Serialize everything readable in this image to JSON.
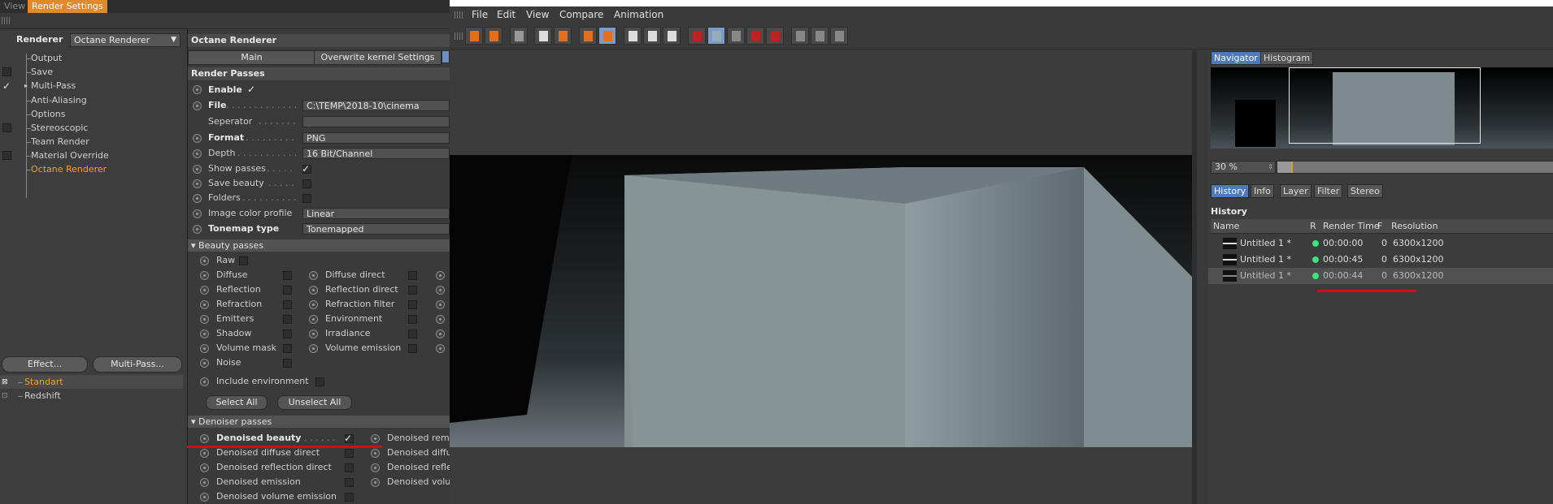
{
  "top_tabs": [
    "View",
    "Render Settings"
  ],
  "left": {
    "renderer_label": "Renderer",
    "renderer_value": "Octane Renderer",
    "tree": [
      "Output",
      "Save",
      "Multi-Pass",
      "Anti-Aliasing",
      "Options",
      "Stereoscopic",
      "Team Render",
      "Material Override",
      "Octane Renderer"
    ],
    "effect_button": "Effect...",
    "multipass_button": "Multi-Pass...",
    "settings_list": [
      "Standart",
      "Redshift"
    ]
  },
  "settings": {
    "header": "Octane Renderer",
    "tabs": [
      "Main",
      "Overwrite kernel Settings"
    ],
    "section": "Render Passes",
    "enable_label": "Enable",
    "file_label": "File",
    "file_value": "C:\\TEMP\\2018-10\\cinema",
    "separator_label": "Seperator",
    "separator_value": "_",
    "format_label": "Format",
    "format_value": "PNG",
    "depth_label": "Depth",
    "depth_value": "16 Bit/Channel",
    "show_passes_label": "Show passes",
    "save_beauty_label": "Save beauty",
    "folders_label": "Folders",
    "color_profile_label": "Image color profile",
    "color_profile_value": "Linear",
    "tonemap_label": "Tonemap type",
    "tonemap_value": "Tonemapped",
    "beauty_header": "Beauty passes",
    "beauty_raw": "Raw",
    "beauty_col1": [
      "Diffuse",
      "Reflection",
      "Refraction",
      "Emitters",
      "Shadow",
      "Volume mask",
      "Noise"
    ],
    "beauty_col2": [
      "Diffuse direct",
      "Reflection direct",
      "Refraction filter",
      "Environment",
      "Irradiance",
      "Volume emission"
    ],
    "include_env": "Include environment",
    "select_all": "Select All",
    "unselect_all": "Unselect All",
    "denoiser_header": "Denoiser passes",
    "denoiser_col1": [
      "Denoised beauty",
      "Denoised diffuse direct",
      "Denoised reflection direct",
      "Denoised emission",
      "Denoised volume emission"
    ],
    "denoiser_col2": [
      "Denoised rem",
      "Denoised diffu",
      "Denoised refle",
      "Denoised volu"
    ]
  },
  "viewer": {
    "menu": [
      "File",
      "Edit",
      "View",
      "Compare",
      "Animation"
    ],
    "nav_tabs": [
      "Navigator",
      "Histogram"
    ],
    "zoom": "30 %",
    "zoom_fraction": 0.3,
    "info_tabs": [
      "History",
      "Info",
      "Layer",
      "Filter",
      "Stereo"
    ],
    "history_title": "History",
    "columns": [
      "Name",
      "R",
      "Render Time",
      "F",
      "Resolution"
    ],
    "rows": [
      {
        "name": "Untitled 1 *",
        "time": "00:00:00",
        "f": "0",
        "res": "6300x1200"
      },
      {
        "name": "Untitled 1 *",
        "time": "00:00:45",
        "f": "0",
        "res": "6300x1200"
      },
      {
        "name": "Untitled 1 *",
        "time": "00:00:44",
        "f": "0",
        "res": "6300x1200"
      }
    ]
  },
  "colors": {
    "accent_orange": "#e08a2c",
    "highlight_blue": "#4f79b8",
    "status_green": "#3ee080",
    "annotation_red": "#d01010"
  }
}
